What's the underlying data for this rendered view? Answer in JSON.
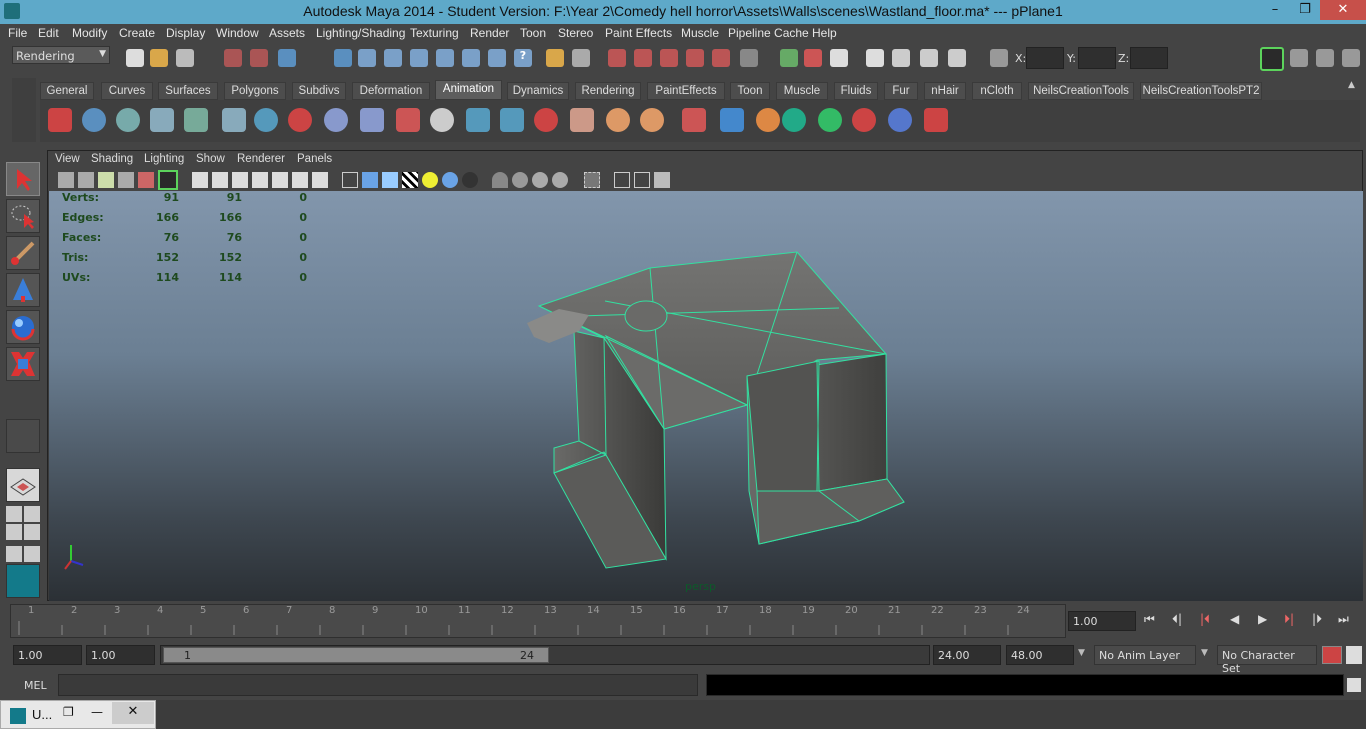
{
  "title": "Autodesk Maya 2014 - Student Version: F:\\Year 2\\Comedy hell horror\\Assets\\Walls\\scenes\\Wastland_floor.ma*   ---   pPlane1",
  "window_controls": {
    "minimize": "–",
    "restore": "❐",
    "close": "✕"
  },
  "menu": [
    "File",
    "Edit",
    "Modify",
    "Create",
    "Display",
    "Window",
    "Assets",
    "Lighting/Shading",
    "Texturing",
    "Render",
    "Toon",
    "Stereo",
    "Paint Effects",
    "Muscle",
    "Pipeline Cache",
    "Help"
  ],
  "status": {
    "menuset": "Rendering",
    "x_label": "X:",
    "y_label": "Y:",
    "z_label": "Z:"
  },
  "shelf_tabs": [
    "General",
    "Curves",
    "Surfaces",
    "Polygons",
    "Subdivs",
    "Deformation",
    "Animation",
    "Dynamics",
    "Rendering",
    "PaintEffects",
    "Toon",
    "Muscle",
    "Fluids",
    "Fur",
    "nHair",
    "nCloth",
    "NeilsCreationTools",
    "NeilsCreationToolsPT2"
  ],
  "active_shelf_tab": "Animation",
  "viewport_menu": [
    "View",
    "Shading",
    "Lighting",
    "Show",
    "Renderer",
    "Panels"
  ],
  "hud": {
    "rows": [
      {
        "label": "Verts:",
        "a": "91",
        "b": "91",
        "c": "0"
      },
      {
        "label": "Edges:",
        "a": "166",
        "b": "166",
        "c": "0"
      },
      {
        "label": "Faces:",
        "a": "76",
        "b": "76",
        "c": "0"
      },
      {
        "label": "Tris:",
        "a": "152",
        "b": "152",
        "c": "0"
      },
      {
        "label": "UVs:",
        "a": "114",
        "b": "114",
        "c": "0"
      }
    ],
    "camera": "persp"
  },
  "timeline": {
    "ticks": [
      "1",
      "2",
      "3",
      "4",
      "5",
      "6",
      "7",
      "8",
      "9",
      "10",
      "11",
      "12",
      "13",
      "14",
      "15",
      "16",
      "17",
      "18",
      "19",
      "20",
      "21",
      "22",
      "23",
      "24"
    ],
    "current_frame": "1.00"
  },
  "range": {
    "start": "1.00",
    "playback_start": "1.00",
    "slider_start": "1",
    "slider_end": "24",
    "playback_end": "24.00",
    "end": "48.00",
    "anim_layer": "No Anim Layer",
    "character_set": "No Character Set"
  },
  "mel_label": "MEL",
  "taskbar": {
    "label": "U...",
    "restore": "❐",
    "minimize": "—",
    "close": "✕"
  },
  "colors": {
    "wire": "#33e0a0",
    "title_bg": "#5ea9c9",
    "close_bg": "#c7504a"
  }
}
